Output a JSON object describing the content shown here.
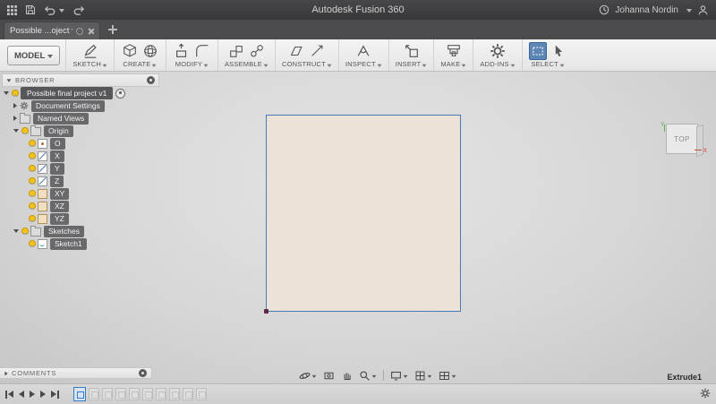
{
  "titlebar": {
    "title": "Autodesk Fusion 360",
    "user_name": "Johanna Nordin"
  },
  "tabbar": {
    "active_tab_label": "Possible ...oject v1*"
  },
  "toolbar": {
    "workspace_label": "MODEL",
    "groups": [
      {
        "label": "SKETCH"
      },
      {
        "label": "CREATE"
      },
      {
        "label": "MODIFY"
      },
      {
        "label": "ASSEMBLE"
      },
      {
        "label": "CONSTRUCT"
      },
      {
        "label": "INSPECT"
      },
      {
        "label": "INSERT"
      },
      {
        "label": "MAKE"
      },
      {
        "label": "ADD-INS"
      },
      {
        "label": "SELECT"
      }
    ]
  },
  "browser": {
    "header_label": "BROWSER",
    "root_label": "Possible final project v1",
    "items": [
      {
        "label": "Document Settings"
      },
      {
        "label": "Named Views"
      },
      {
        "label": "Origin"
      },
      {
        "label": "O"
      },
      {
        "label": "X"
      },
      {
        "label": "Y"
      },
      {
        "label": "Z"
      },
      {
        "label": "XY"
      },
      {
        "label": "XZ"
      },
      {
        "label": "YZ"
      },
      {
        "label": "Sketches"
      },
      {
        "label": "Sketch1"
      }
    ]
  },
  "viewcube": {
    "face_label": "TOP",
    "axis_x_label": "X",
    "axis_y_label": "Y"
  },
  "comments_panel": {
    "label": "COMMENTS"
  },
  "timeline": {
    "feature_label": "Extrude1"
  },
  "colors": {
    "selection_blue": "#4a7ab5",
    "sketch_fill": "#ebe3d7",
    "timeline_active_border": "#3a7bc8",
    "badge_gray": "#69696b"
  }
}
